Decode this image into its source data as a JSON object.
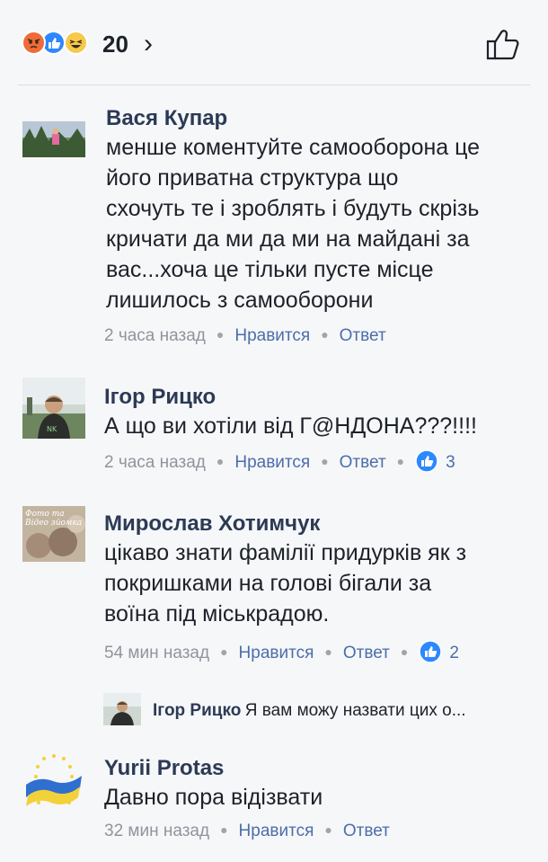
{
  "header": {
    "reaction_count": "20",
    "chevron": "›",
    "colors": {
      "angry": "#ef6b3a",
      "like": "#2d88ff",
      "haha": "#f7c94a"
    }
  },
  "comments": [
    {
      "name": "Вася Купар",
      "lines": [
        "менше коментуйте самооборона це",
        "його приватна структура що",
        "схочуть те і зроблять і будуть скрізь",
        "кричати да ми да ми на майдані за",
        "вас...хоча це тільки пусте місце",
        "лишилось з самооборони"
      ],
      "time": "2 часа назад",
      "like": "Нравится",
      "reply": "Ответ"
    },
    {
      "name": "Ігор Рицко",
      "lines": [
        "А що ви хотіли від Г@НДОНА???!!!!"
      ],
      "time": "2 часа назад",
      "like": "Нравится",
      "reply": "Ответ",
      "reactions": "3"
    },
    {
      "name": "Мирослав Хотимчук",
      "avatar_text": "Фото та Відео зйомка",
      "lines": [
        "цікаво знати фамілії придурків як з",
        "покришками на голові бігали за",
        "воїна під міськрадою."
      ],
      "time": "54 мин назад",
      "like": "Нравится",
      "reply": "Ответ",
      "reactions": "2",
      "reply_preview": {
        "name": "Ігор Рицко",
        "text": "Я вам можу назвати цих о..."
      }
    },
    {
      "name": "Yurii Protas",
      "lines": [
        "Давно пора відізвати"
      ],
      "time": "32 мин назад",
      "like": "Нравится",
      "reply": "Ответ"
    }
  ]
}
